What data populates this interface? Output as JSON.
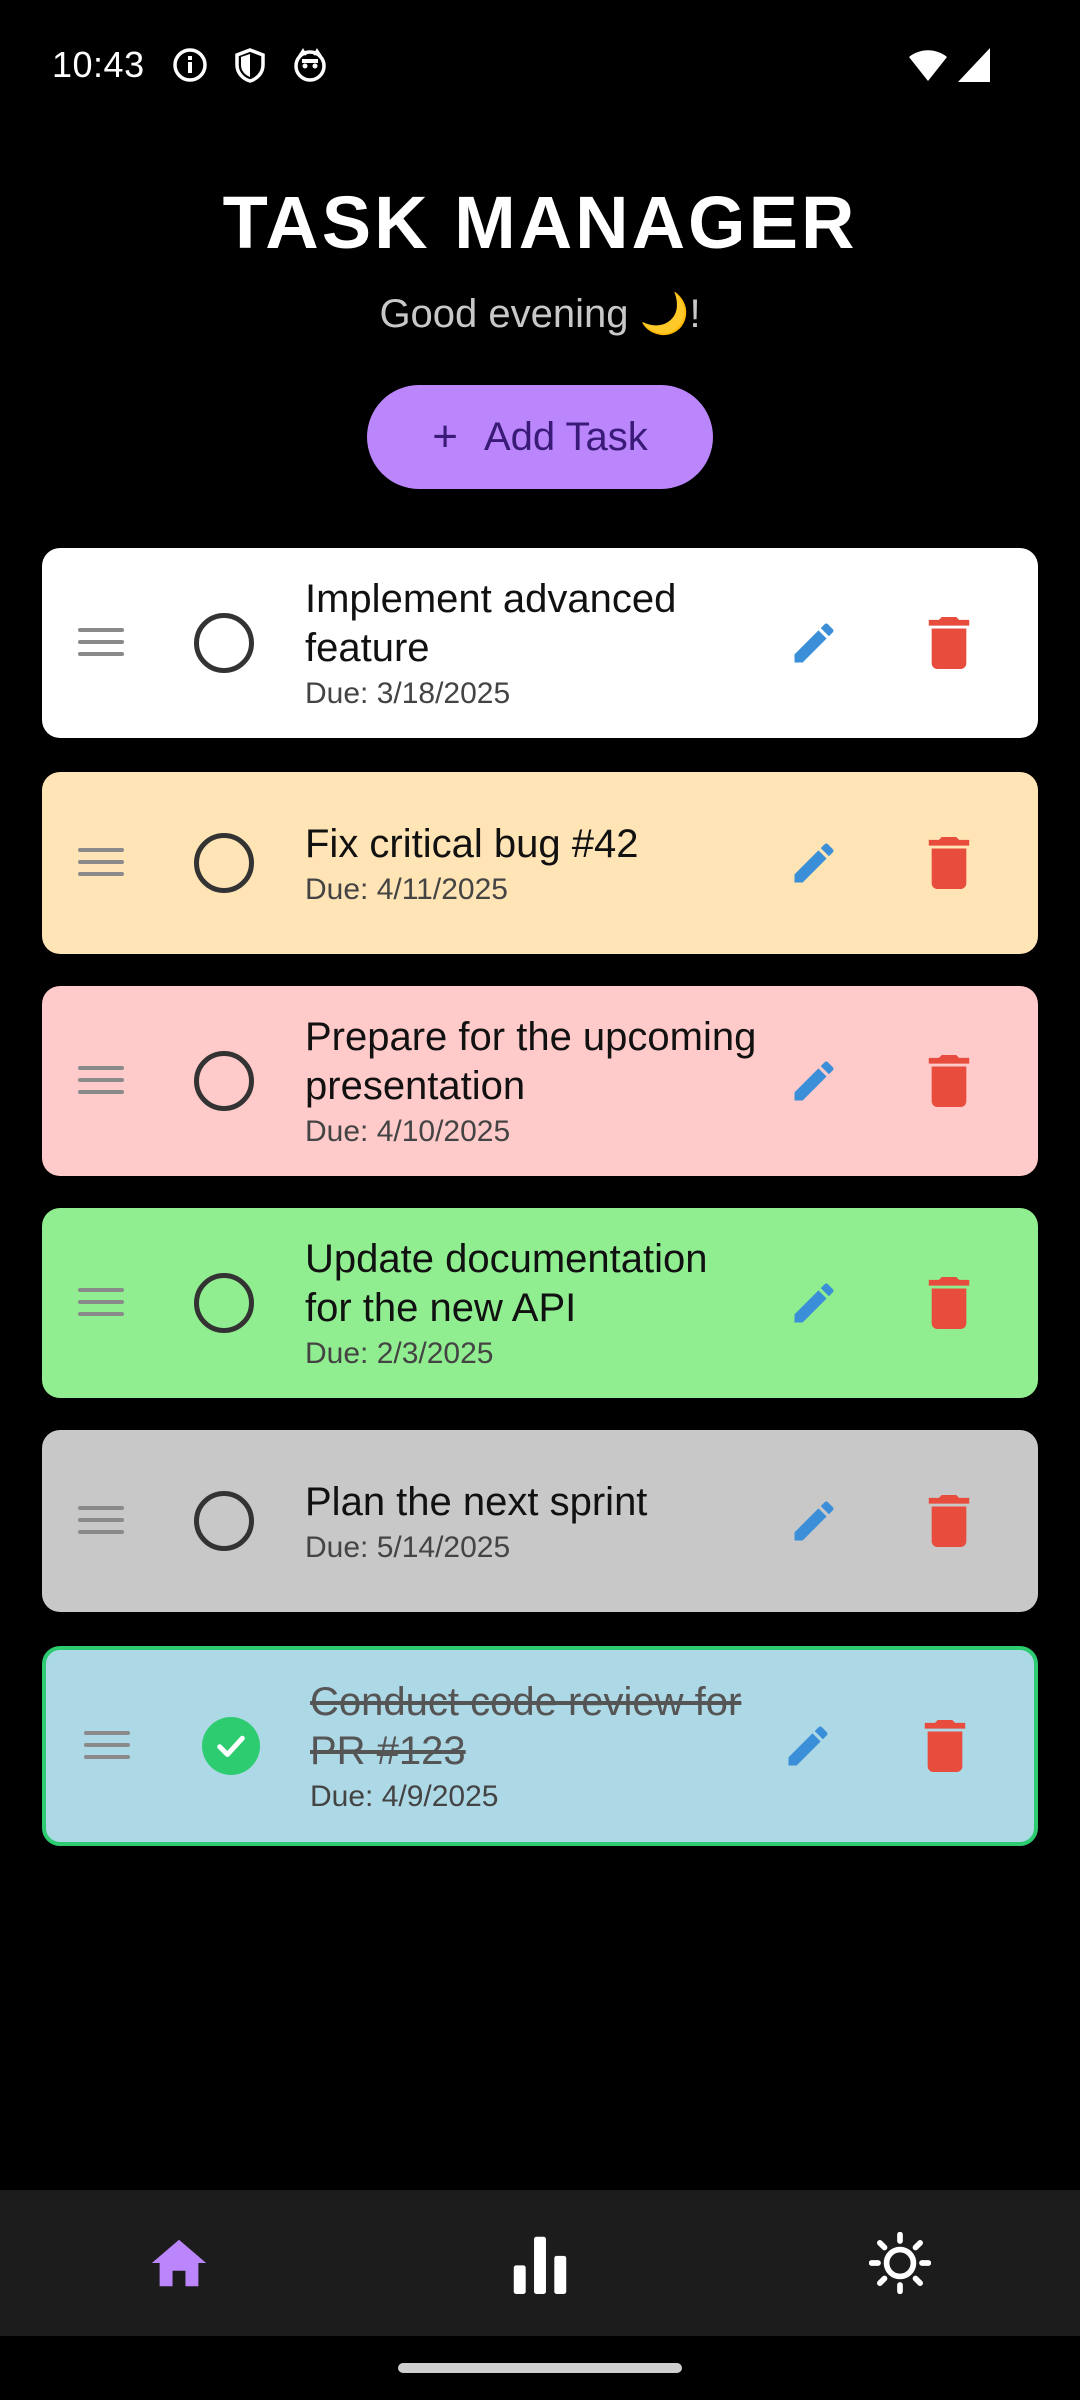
{
  "status_bar": {
    "time": "10:43",
    "left_icons": [
      "info-icon",
      "shield-icon",
      "cat-face-icon"
    ],
    "right_icons": [
      "wifi-icon",
      "signal-icon"
    ]
  },
  "header": {
    "title": "TASK MANAGER",
    "greeting": "Good evening 🌙!"
  },
  "add_task": {
    "label": "Add Task",
    "icon": "plus-icon"
  },
  "tasks": [
    {
      "title": "Implement advanced feature",
      "due": "Due: 3/18/2025",
      "completed": false,
      "color": "#ffffff"
    },
    {
      "title": "Fix critical bug #42",
      "due": "Due: 4/11/2025",
      "completed": false,
      "color": "#ffe4b5"
    },
    {
      "title": "Prepare for the upcoming presentation",
      "due": "Due: 4/10/2025",
      "completed": false,
      "color": "#ffcaca"
    },
    {
      "title": "Update documentation for the new API",
      "due": "Due: 2/3/2025",
      "completed": false,
      "color": "#90ee90"
    },
    {
      "title": "Plan the next sprint",
      "due": "Due: 5/14/2025",
      "completed": false,
      "color": "#c8c8c8"
    },
    {
      "title": "Conduct code review for PR #123",
      "due": "Due: 4/9/2025",
      "completed": true,
      "color": "#add8e6"
    }
  ],
  "colors": {
    "accent": "#bb86fc",
    "edit_icon": "#3a8fd8",
    "delete_icon": "#e74c3c",
    "done_check": "#2ecc71",
    "done_border": "#2ecc71",
    "nav_background": "#1c1c1c"
  },
  "bottom_nav": {
    "items": [
      {
        "icon": "home-icon",
        "active": true
      },
      {
        "icon": "bar-chart-icon",
        "active": false
      },
      {
        "icon": "sun-icon",
        "active": false
      }
    ]
  }
}
